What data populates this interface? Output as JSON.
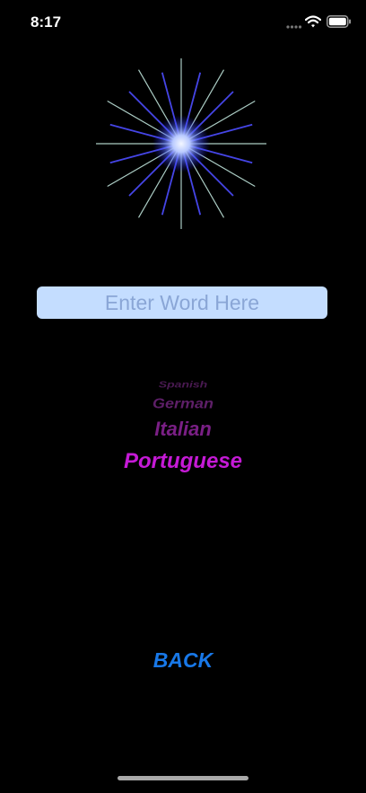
{
  "status_bar": {
    "time": "8:17"
  },
  "search": {
    "placeholder": "Enter Word Here"
  },
  "languages": {
    "items": [
      "Spanish",
      "German",
      "Italian",
      "Portuguese"
    ],
    "selected": "Portuguese"
  },
  "back_label": "BACK",
  "colors": {
    "background": "#000000",
    "input_fill": "#c4ddff",
    "picker_selected": "#c51ad6",
    "back": "#1878e8"
  },
  "icons": [
    "signal-icon",
    "wifi-icon",
    "battery-icon",
    "starburst-icon"
  ]
}
